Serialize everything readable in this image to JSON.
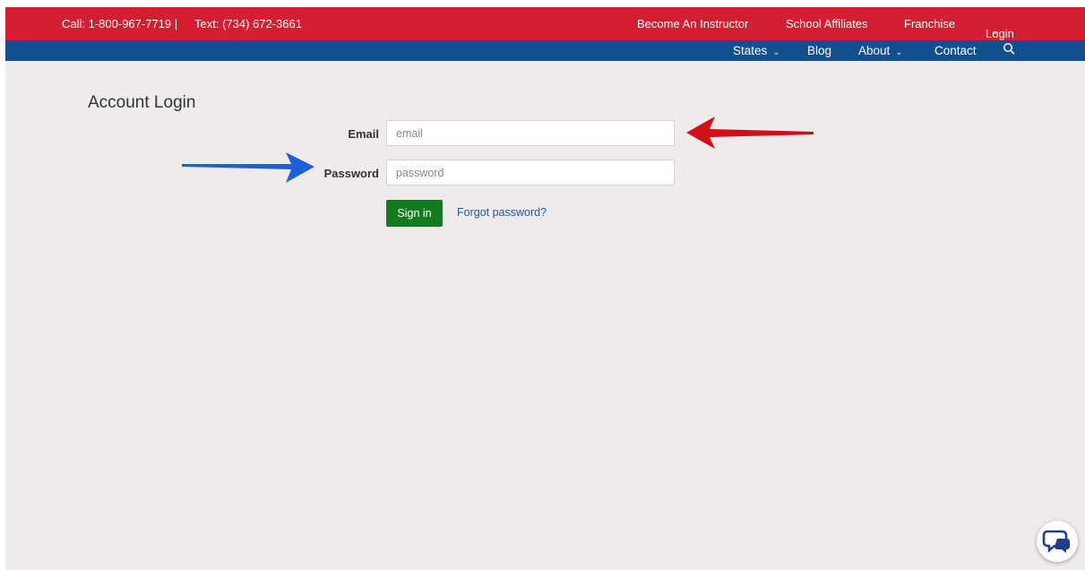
{
  "topbar": {
    "call": "Call: 1-800-967-7719 |",
    "text": "Text: (734) 672-3661",
    "links": [
      "Become An Instructor",
      "School Affiliates",
      "Franchise"
    ],
    "login": "Login"
  },
  "navbar": {
    "states": "States",
    "blog": "Blog",
    "about": "About",
    "contact": "Contact"
  },
  "form": {
    "title": "Account Login",
    "email_label": "Email",
    "email_placeholder": "email",
    "password_label": "Password",
    "password_placeholder": "password",
    "signin_label": "Sign in",
    "forgot_label": "Forgot password?"
  },
  "icons": {
    "search": "search-icon",
    "chat": "chat-icon",
    "chevron": "chevron-down-icon"
  },
  "colors": {
    "topbar": "#d41f32",
    "navbar": "#124f8f",
    "background": "#efebea",
    "signin": "#137a20",
    "link": "#1a5aa0",
    "red_arrow": "#d01018",
    "blue_arrow": "#1e5fd8"
  }
}
